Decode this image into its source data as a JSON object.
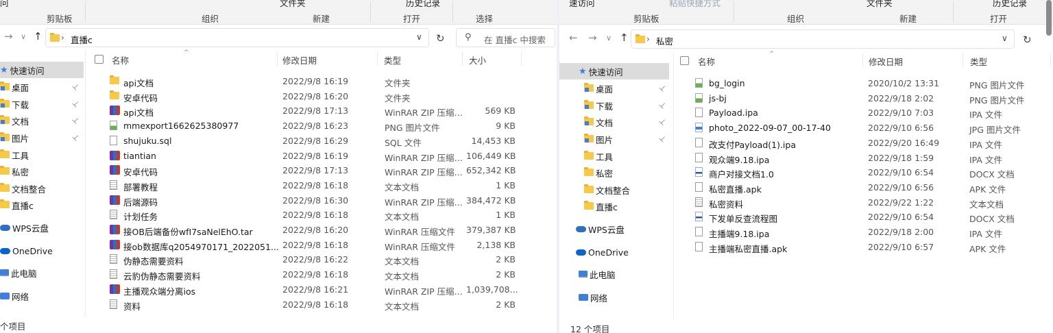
{
  "left": {
    "ribbon": {
      "tops": [
        "问",
        "文件夹",
        "历史记录"
      ],
      "groups": [
        "剪贴板",
        "组织",
        "新建",
        "打开",
        "选择"
      ]
    },
    "address": {
      "crumb": "直播c",
      "search_placeholder": "在 直播c 中搜索"
    },
    "nav": [
      {
        "label": "快速访问",
        "icon": "star-icon",
        "selected": true,
        "pinned": false
      },
      {
        "label": "桌面",
        "icon": "desktop-folder-icon",
        "pinned": true
      },
      {
        "label": "下载",
        "icon": "downloads-folder-icon",
        "pinned": true
      },
      {
        "label": "文档",
        "icon": "documents-folder-icon",
        "pinned": true
      },
      {
        "label": "图片",
        "icon": "pictures-folder-icon",
        "pinned": true
      },
      {
        "label": "工具",
        "icon": "folder-icon",
        "pinned": false
      },
      {
        "label": "私密",
        "icon": "folder-icon",
        "pinned": false
      },
      {
        "label": "文档整合",
        "icon": "folder-icon",
        "pinned": false
      },
      {
        "label": "直播c",
        "icon": "folder-icon",
        "pinned": false
      },
      {
        "label": "WPS云盘",
        "icon": "wps-cloud-icon",
        "pinned": false
      },
      {
        "label": "OneDrive",
        "icon": "onedrive-icon",
        "pinned": false
      },
      {
        "label": "此电脑",
        "icon": "this-pc-icon",
        "pinned": false
      },
      {
        "label": "网络",
        "icon": "network-icon",
        "pinned": false
      }
    ],
    "columns": {
      "name": "名称",
      "date": "修改日期",
      "type": "类型",
      "size": "大小"
    },
    "files": [
      {
        "name": "api文档",
        "date": "2022/9/8 16:19",
        "type": "文件夹",
        "size": "",
        "icon": "folder"
      },
      {
        "name": "安卓代码",
        "date": "2022/9/8 16:20",
        "type": "文件夹",
        "size": "",
        "icon": "folder"
      },
      {
        "name": "api文档",
        "date": "2022/9/8 17:13",
        "type": "WinRAR ZIP 压缩...",
        "size": "569 KB",
        "icon": "zip"
      },
      {
        "name": "mmexport1662625380977",
        "date": "2022/9/8 16:23",
        "type": "PNG 图片文件",
        "size": "9 KB",
        "icon": "png"
      },
      {
        "name": "shujuku.sql",
        "date": "2022/9/8 16:29",
        "type": "SQL 文件",
        "size": "14,453 KB",
        "icon": "doc"
      },
      {
        "name": "tiantian",
        "date": "2022/9/8 16:19",
        "type": "WinRAR ZIP 压缩...",
        "size": "106,449 KB",
        "icon": "zip"
      },
      {
        "name": "安卓代码",
        "date": "2022/9/8 17:13",
        "type": "WinRAR ZIP 压缩...",
        "size": "652,342 KB",
        "icon": "zip"
      },
      {
        "name": "部署教程",
        "date": "2022/9/8 16:18",
        "type": "文本文档",
        "size": "1 KB",
        "icon": "txt"
      },
      {
        "name": "后端源码",
        "date": "2022/9/8 16:30",
        "type": "WinRAR ZIP 压缩...",
        "size": "384,472 KB",
        "icon": "zip"
      },
      {
        "name": "计划任务",
        "date": "2022/9/8 16:18",
        "type": "文本文档",
        "size": "1 KB",
        "icon": "txt"
      },
      {
        "name": "接OB后端备份wfI7saNelEhO.tar",
        "date": "2022/9/8 16:20",
        "type": "WinRAR 压缩文件",
        "size": "379,387 KB",
        "icon": "zip"
      },
      {
        "name": "接ob数据库q2054970171_2022051...",
        "date": "2022/9/8 16:18",
        "type": "WinRAR 压缩文件",
        "size": "2,138 KB",
        "icon": "zip"
      },
      {
        "name": "伪静态需要资料",
        "date": "2022/9/8 16:22",
        "type": "文本文档",
        "size": "2 KB",
        "icon": "txt"
      },
      {
        "name": "云豹伪静态需要资料",
        "date": "2022/9/8 16:18",
        "type": "文本文档",
        "size": "2 KB",
        "icon": "txt"
      },
      {
        "name": "主播观众端分离ios",
        "date": "2022/9/8 16:21",
        "type": "WinRAR ZIP 压缩...",
        "size": "1,039,708...",
        "icon": "zip"
      },
      {
        "name": "资料",
        "date": "2022/9/8 16:18",
        "type": "文本文档",
        "size": "2 KB",
        "icon": "txt"
      }
    ],
    "status": "个项目"
  },
  "right": {
    "ribbon": {
      "tops": [
        "速访问",
        "粘贴快捷方式",
        "文件夹",
        "历史记录"
      ],
      "groups": [
        "剪贴板",
        "组织",
        "新建",
        "打开"
      ]
    },
    "address": {
      "crumb": "私密"
    },
    "nav": [
      {
        "label": "快速访问",
        "icon": "star-icon",
        "selected": true,
        "pinned": false
      },
      {
        "label": "桌面",
        "icon": "desktop-folder-icon",
        "pinned": true
      },
      {
        "label": "下载",
        "icon": "downloads-folder-icon",
        "pinned": true
      },
      {
        "label": "文档",
        "icon": "documents-folder-icon",
        "pinned": true
      },
      {
        "label": "图片",
        "icon": "pictures-folder-icon",
        "pinned": true
      },
      {
        "label": "工具",
        "icon": "folder-icon",
        "pinned": false
      },
      {
        "label": "私密",
        "icon": "folder-icon",
        "pinned": false
      },
      {
        "label": "文档整合",
        "icon": "folder-icon",
        "pinned": false
      },
      {
        "label": "直播c",
        "icon": "folder-icon",
        "pinned": false
      },
      {
        "label": "WPS云盘",
        "icon": "wps-cloud-icon",
        "pinned": false
      },
      {
        "label": "OneDrive",
        "icon": "onedrive-icon",
        "pinned": false
      },
      {
        "label": "此电脑",
        "icon": "this-pc-icon",
        "pinned": false
      },
      {
        "label": "网络",
        "icon": "network-icon",
        "pinned": false
      }
    ],
    "columns": {
      "name": "名称",
      "date": "修改日期",
      "type": "类型"
    },
    "files": [
      {
        "name": "bg_login",
        "date": "2020/10/2 13:31",
        "type": "PNG 图片文件",
        "icon": "png"
      },
      {
        "name": "js-bj",
        "date": "2022/9/18 2:02",
        "type": "PNG 图片文件",
        "icon": "png"
      },
      {
        "name": "Payload.ipa",
        "date": "2022/9/10 7:03",
        "type": "IPA 文件",
        "icon": "doc"
      },
      {
        "name": "photo_2022-09-07_00-17-40",
        "date": "2022/9/10 6:56",
        "type": "JPG 图片文件",
        "icon": "jpg"
      },
      {
        "name": "改支付Payload(1).ipa",
        "date": "2022/9/20 16:49",
        "type": "IPA 文件",
        "icon": "doc"
      },
      {
        "name": "观众端9.18.ipa",
        "date": "2022/9/18 1:59",
        "type": "IPA 文件",
        "icon": "doc"
      },
      {
        "name": "商户对接文档1.0",
        "date": "2022/9/10 6:54",
        "type": "DOCX 文档",
        "icon": "docx"
      },
      {
        "name": "私密直播.apk",
        "date": "2022/9/10 6:56",
        "type": "APK 文件",
        "icon": "doc"
      },
      {
        "name": "私密资料",
        "date": "2022/9/22 1:22",
        "type": "文本文档",
        "icon": "txt"
      },
      {
        "name": "下发单反查流程图",
        "date": "2022/9/10 6:54",
        "type": "DOCX 文档",
        "icon": "docx"
      },
      {
        "name": "主播端9.18.ipa",
        "date": "2022/9/18 2:00",
        "type": "IPA 文件",
        "icon": "doc"
      },
      {
        "name": "主播端私密直播.apk",
        "date": "2022/9/10 6:57",
        "type": "APK 文件",
        "icon": "doc"
      }
    ],
    "status": "12 个项目"
  },
  "glyphs": {
    "back": "←",
    "forward": "→",
    "recent": "∨",
    "up": "↑",
    "chevron": "›",
    "dropdown": "∨",
    "refresh": "↻",
    "search": "⚲",
    "pin": "📌",
    "sort": "^",
    "star": "★"
  }
}
